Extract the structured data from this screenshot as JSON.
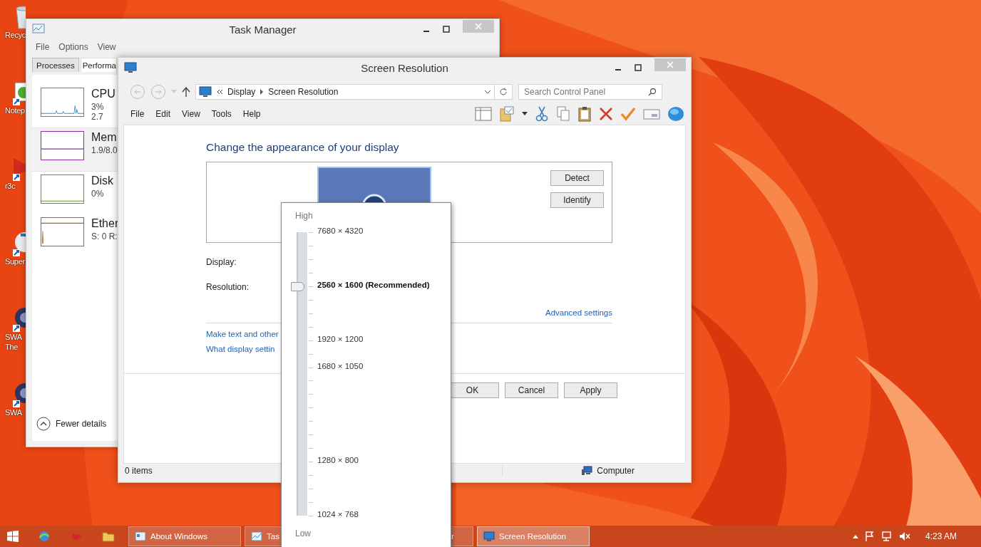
{
  "desktop_icons": [
    {
      "kind": "bin",
      "label": "Recyc"
    },
    {
      "kind": "notepad",
      "label": "Notep"
    },
    {
      "kind": "r3",
      "label": "r3c"
    },
    {
      "kind": "globe",
      "label": "Super"
    },
    {
      "kind": "disc",
      "label": "SWA The"
    },
    {
      "kind": "disc",
      "label": "SWA"
    }
  ],
  "task_manager": {
    "title": "Task Manager",
    "menu": [
      "File",
      "Options",
      "View"
    ],
    "tabs": [
      {
        "label": "Processes",
        "selected": false
      },
      {
        "label": "Performa",
        "selected": true
      }
    ],
    "resources": [
      {
        "kind": "spikes",
        "name": "CPU",
        "value": "3% 2.7",
        "color": "#3c8dbc",
        "selected": false
      },
      {
        "kind": "band",
        "name": "Mem",
        "value": "1.9/8.0",
        "color": "#8b2fa6",
        "selected": true
      },
      {
        "kind": "flat",
        "name": "Disk",
        "value": "0%",
        "color": "#5a9a2a",
        "selected": false
      },
      {
        "kind": "spike",
        "name": "Ether",
        "value": "S: 0 R:",
        "color": "#a8661e",
        "selected": false
      }
    ],
    "fewer_details": "Fewer details"
  },
  "screen_resolution": {
    "title": "Screen Resolution",
    "breadcrumb": [
      "Display",
      "Screen Resolution"
    ],
    "search": {
      "placeholder": "Search Control Panel"
    },
    "menu": [
      "File",
      "Edit",
      "View",
      "Tools",
      "Help"
    ],
    "heading": "Change the appearance of your display",
    "preview_buttons": [
      "Detect",
      "Identify"
    ],
    "display_label": "Display:",
    "resolution_label": "Resolution:",
    "advanced_link": "Advanced settings",
    "links": [
      "Make text and other",
      "What display settin"
    ],
    "dialog_buttons": [
      "OK",
      "Cancel",
      "Apply"
    ],
    "status_bar": {
      "items": "0 items",
      "location": "Computer"
    }
  },
  "resolution_popup": {
    "high": "High",
    "low": "Low",
    "level": 0.81,
    "options": [
      {
        "label": "7680 × 4320",
        "selected": false
      },
      {
        "label": "2560 × 1600 (Recommended)",
        "selected": true
      },
      {
        "label": "1920 × 1200",
        "selected": false
      },
      {
        "label": "1680 × 1050",
        "selected": false
      },
      {
        "label": "1280 × 800",
        "selected": false
      },
      {
        "label": "1024 × 768",
        "selected": false
      }
    ]
  },
  "taskbar": {
    "tasks": [
      {
        "kind": "window",
        "label": "About Windows",
        "selected": false
      },
      {
        "kind": "taskmgr",
        "label": "Tas",
        "selected": false
      },
      {
        "kind": "hidden",
        "label": "r",
        "selected": false
      },
      {
        "kind": "display",
        "label": "Screen Resolution",
        "selected": true
      }
    ],
    "clock": "4:23 AM"
  }
}
